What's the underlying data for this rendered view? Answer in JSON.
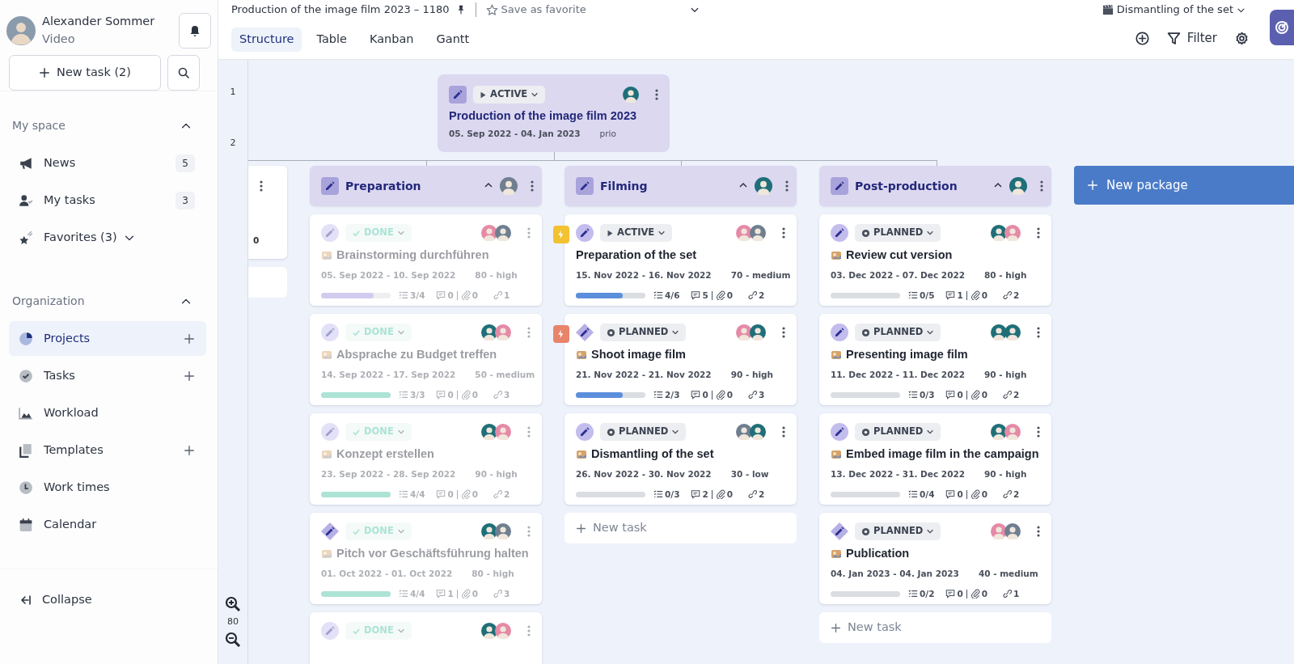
{
  "sidebar": {
    "user": {
      "name": "Alexander Sommer",
      "role": "Video"
    },
    "new_task_button": "New task (2)",
    "sections": [
      {
        "title": "My space",
        "expanded": true,
        "items": [
          {
            "label": "News",
            "kind": "count",
            "count": "5",
            "selected": false
          },
          {
            "label": "My tasks",
            "kind": "count",
            "count": "3",
            "selected": false
          },
          {
            "label": "Favorites (3)",
            "kind": "dropdown",
            "selected": false
          }
        ]
      },
      {
        "title": "Organization",
        "expanded": true,
        "items": [
          {
            "label": "Projects",
            "kind": "add",
            "selected": true
          },
          {
            "label": "Tasks",
            "kind": "add",
            "selected": false
          },
          {
            "label": "Workload",
            "kind": "plain",
            "selected": false
          },
          {
            "label": "Templates",
            "kind": "add",
            "selected": false
          },
          {
            "label": "Work times",
            "kind": "plain",
            "selected": false
          },
          {
            "label": "Calendar",
            "kind": "plain",
            "selected": false
          }
        ]
      }
    ],
    "collapse_label": "Collapse"
  },
  "topbar": {
    "project_title": "Production of the image film 2023 – 1180",
    "pinned": true,
    "favorite_label": "Save as favorite",
    "tabs": [
      {
        "label": "Structure",
        "selected": true
      },
      {
        "label": "Table",
        "selected": false
      },
      {
        "label": "Kanban",
        "selected": false
      },
      {
        "label": "Gantt",
        "selected": false
      }
    ],
    "current_task": "Dismantling of the set",
    "filter_label": "Filter"
  },
  "board": {
    "row_numbers": [
      "1",
      "2"
    ],
    "zoom": "80",
    "root": {
      "status": "ACTIVE",
      "kind": "active",
      "title": "Production of the image film 2023",
      "dates": "05. Sep 2022 - 04. Jan 2023",
      "priority": "prio",
      "avatars": [
        {
          "color": "#1f6f78"
        }
      ]
    },
    "offscreen_column": {
      "reading": "0"
    },
    "columns": [
      {
        "title": "Preparation",
        "expanded": true,
        "avatar": {
          "color": "#6f7f90"
        },
        "cards": [
          {
            "status": "DONE",
            "kind": "done",
            "milestone": false,
            "has_icon": true,
            "title": "Brainstorming durchführen",
            "dates": "05. Sep 2022 - 10. Sep 2022",
            "priority": "80 - high",
            "level": 0.75,
            "subtasks": "3/4",
            "comments": "0",
            "attachments": "0",
            "links": "1",
            "avatars": [
              {
                "color": "#e58aa6"
              },
              {
                "color": "#6f7f90"
              }
            ]
          },
          {
            "status": "DONE",
            "kind": "done",
            "milestone": false,
            "has_icon": true,
            "title": "Absprache zu Budget treffen",
            "dates": "14. Sep 2022 - 17. Sep 2022",
            "priority": "50 - medium",
            "level": 1,
            "subtasks": "3/3",
            "comments": "0",
            "attachments": "0",
            "links": "3",
            "avatars": [
              {
                "color": "#1f6f78"
              },
              {
                "color": "#e58aa6"
              }
            ]
          },
          {
            "status": "DONE",
            "kind": "done",
            "milestone": false,
            "has_icon": true,
            "title": "Konzept erstellen",
            "dates": "23. Sep 2022 - 28. Sep 2022",
            "priority": "90 - high",
            "level": 1,
            "subtasks": "4/4",
            "comments": "0",
            "attachments": "0",
            "links": "2",
            "avatars": [
              {
                "color": "#1f6f78"
              },
              {
                "color": "#e58aa6"
              }
            ]
          },
          {
            "status": "DONE",
            "kind": "done",
            "milestone": true,
            "has_icon": true,
            "title": "Pitch vor Geschäftsführung halten",
            "dates": "01. Oct 2022 - 01. Oct 2022",
            "priority": "80 - high",
            "level": 1,
            "subtasks": "4/4",
            "comments": "1",
            "attachments": "0",
            "links": "3",
            "avatars": [
              {
                "color": "#1f6f78"
              },
              {
                "color": "#6f7f90"
              }
            ]
          },
          {
            "status": "DONE",
            "kind": "done",
            "milestone": false,
            "avatars": [
              {
                "color": "#1f6f78"
              },
              {
                "color": "#e58aa6"
              }
            ]
          }
        ]
      },
      {
        "title": "Filming",
        "expanded": true,
        "avatar": {
          "color": "#1f6f78"
        },
        "cards": [
          {
            "status": "ACTIVE",
            "kind": "active",
            "milestone": false,
            "flag": {
              "color": "#f2c230"
            },
            "has_icon": false,
            "title": "Preparation of the set",
            "dates": "15. Nov 2022 - 16. Nov 2022",
            "priority": "70 - medium",
            "level": 0.67,
            "subtasks": "4/6",
            "comments": "5",
            "attachments": "0",
            "links": "2",
            "avatars": [
              {
                "color": "#e58aa6"
              },
              {
                "color": "#6f7f90"
              }
            ]
          },
          {
            "status": "PLANNED",
            "kind": "planned",
            "milestone": true,
            "flag": {
              "color": "#e8846a"
            },
            "has_icon": true,
            "title": "Shoot image film",
            "dates": "21. Nov 2022 - 21. Nov 2022",
            "priority": "90 - high",
            "level": 0.67,
            "subtasks": "2/3",
            "comments": "0",
            "attachments": "0",
            "links": "3",
            "avatars": [
              {
                "color": "#e58aa6"
              },
              {
                "color": "#1f6f78"
              }
            ]
          },
          {
            "status": "PLANNED",
            "kind": "planned",
            "milestone": false,
            "has_icon": true,
            "title": "Dismantling of the set",
            "dates": "26. Nov 2022 - 30. Nov 2022",
            "priority": "30 - low",
            "level": 0,
            "subtasks": "0/3",
            "comments": "2",
            "attachments": "0",
            "links": "2",
            "avatars": [
              {
                "color": "#6f7f90"
              },
              {
                "color": "#1f6f78"
              }
            ]
          }
        ],
        "new_task": "New task"
      },
      {
        "title": "Post-production",
        "expanded": true,
        "avatar": {
          "color": "#1f6f78"
        },
        "cards": [
          {
            "status": "PLANNED",
            "kind": "planned",
            "milestone": false,
            "has_icon": true,
            "title": "Review cut version",
            "dates": "03. Dec 2022 - 07. Dec 2022",
            "priority": "80 - high",
            "level": 0,
            "subtasks": "0/5",
            "comments": "1",
            "attachments": "0",
            "links": "2",
            "avatars": [
              {
                "color": "#1f6f78"
              },
              {
                "color": "#e58aa6"
              }
            ]
          },
          {
            "status": "PLANNED",
            "kind": "planned",
            "milestone": false,
            "has_icon": true,
            "title": "Presenting image film",
            "dates": "11. Dec 2022 - 11. Dec 2022",
            "priority": "90 - high",
            "level": 0,
            "subtasks": "0/3",
            "comments": "0",
            "attachments": "0",
            "links": "2",
            "avatars": [
              {
                "color": "#1f6f78"
              },
              {
                "color": "#1f6f78"
              }
            ]
          },
          {
            "status": "PLANNED",
            "kind": "planned",
            "milestone": false,
            "has_icon": true,
            "title": "Embed image film in the campaign",
            "dates": "13. Dec 2022 - 31. Dec 2022",
            "priority": "90 - high",
            "level": 0,
            "subtasks": "0/4",
            "comments": "0",
            "attachments": "0",
            "links": "2",
            "avatars": [
              {
                "color": "#1f6f78"
              },
              {
                "color": "#e58aa6"
              }
            ]
          },
          {
            "status": "PLANNED",
            "kind": "planned",
            "milestone": true,
            "has_icon": true,
            "title": "Publication",
            "dates": "04. Jan 2023 - 04. Jan 2023",
            "priority": "40 - medium",
            "level": 0,
            "subtasks": "0/2",
            "comments": "0",
            "attachments": "0",
            "links": "1",
            "avatars": [
              {
                "color": "#e58aa6"
              },
              {
                "color": "#6f7f90"
              }
            ]
          }
        ],
        "new_task": "New task"
      }
    ],
    "new_package": "New package"
  }
}
